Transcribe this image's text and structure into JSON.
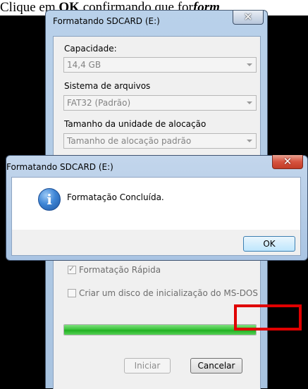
{
  "caption": {
    "part1": "Clique em ",
    "bold": "OK",
    "part2": " confirmando que for",
    "bold_italic": "form"
  },
  "format_dialog": {
    "title": "Formatando SDCARD (E:)",
    "close_glyph": "✕",
    "capacity_label": "Capacidade:",
    "capacity_value": "14,4 GB",
    "filesystem_label": "Sistema de arquivos",
    "filesystem_value": "FAT32 (Padrão)",
    "alloc_label": "Tamanho da unidade de alocação",
    "alloc_value": "Tamanho de alocação padrão",
    "quick_format_label": "Formatação Rápida",
    "quick_format_checked": true,
    "msdos_label": "Criar um disco de inicialização do MS-DOS",
    "msdos_checked": false,
    "progress_fraction": 1.0,
    "progress_color": "#3cc43c",
    "start_button": "Iniciar",
    "cancel_button": "Cancelar"
  },
  "message_box": {
    "title": "Formatando SDCARD (E:)",
    "close_glyph": "✕",
    "icon": "info-icon",
    "icon_glyph": "i",
    "text": "Formatação Concluída.",
    "ok_button": "OK",
    "highlight_color": "#e00000"
  }
}
